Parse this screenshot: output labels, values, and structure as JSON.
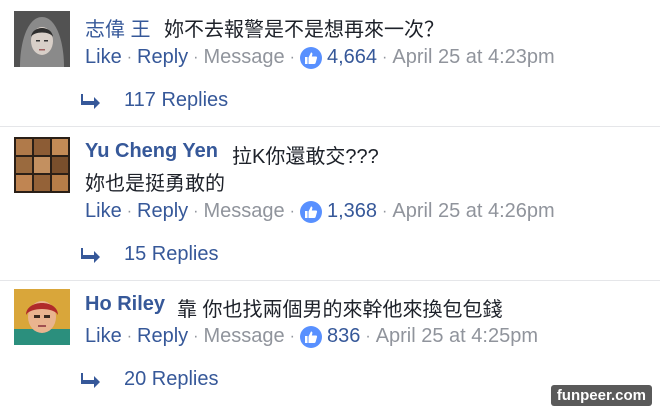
{
  "comments": [
    {
      "author": "志偉 王",
      "text_lines": [
        "妳不去報警是不是想再來一次？"
      ],
      "actions": {
        "like": "Like",
        "reply": "Reply",
        "message": "Message"
      },
      "like_count": "4,664",
      "timestamp": "April 25 at 4:23pm",
      "replies": "117 Replies"
    },
    {
      "author": "Yu Cheng Yen",
      "text_lines": [
        "拉K你還敢交???",
        "妳也是挺勇敢的"
      ],
      "actions": {
        "like": "Like",
        "reply": "Reply",
        "message": "Message"
      },
      "like_count": "1,368",
      "timestamp": "April 25 at 4:26pm",
      "replies": "15 Replies"
    },
    {
      "author": "Ho Riley",
      "text_lines": [
        "靠 你也找兩個男的來幹他來換包包錢"
      ],
      "actions": {
        "like": "Like",
        "reply": "Reply",
        "message": "Message"
      },
      "like_count": "836",
      "timestamp": "April 25 at 4:25pm",
      "replies": "20 Replies"
    }
  ],
  "watermark": "funpeer.com",
  "colors": {
    "link": "#365899",
    "muted": "#90949c",
    "like_badge": "#5890ff",
    "text": "#1d2129"
  },
  "icons": {
    "like_badge": "thumbs-up-icon",
    "reply_arrow": "reply-arrow-icon"
  }
}
